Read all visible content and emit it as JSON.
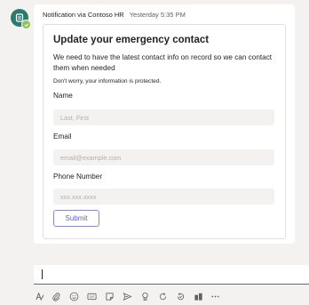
{
  "message": {
    "sender": "Notification via Contoso HR",
    "timestamp": "Yesterday 5:35 PM"
  },
  "card": {
    "title": "Update your emergency contact",
    "description": "We need to have the latest contact info on record so we can contact them when needed",
    "note": "Don't worry, your information is protected.",
    "fields": [
      {
        "label": "Name",
        "placeholder": "Last, First",
        "value": ""
      },
      {
        "label": "Email",
        "placeholder": "email@example.com",
        "value": ""
      },
      {
        "label": "Phone Number",
        "placeholder": "xxx.xxx.xxxx",
        "value": ""
      }
    ],
    "submit_label": "Submit"
  },
  "compose": {
    "value": ""
  },
  "toolbar_icons": [
    "format-icon",
    "attach-icon",
    "emoji-icon",
    "gif-icon",
    "sticker-icon",
    "send-later-icon",
    "praise-icon",
    "loop-icon",
    "approvals-icon",
    "app-icon",
    "more-icon"
  ],
  "colors": {
    "background": "#f3f2f1",
    "accent": "#5b5fc7",
    "avatar": "#2b7a6e",
    "presence": "#92c353"
  }
}
